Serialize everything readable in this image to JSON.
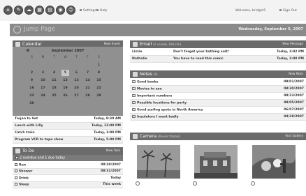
{
  "toolbar": {
    "icons": [
      "home-icon",
      "paperclip-icon",
      "cloud-icon",
      "calendar-icon",
      "document-icon",
      "camera-icon",
      "people-icon"
    ],
    "settings_label": "Settings",
    "help_label": "Help",
    "welcome": "Welcome, bridget1",
    "signout_label": "Sign Out"
  },
  "header": {
    "title": "Jump Page",
    "date": "Wednesday, September 5, 2007"
  },
  "calendar": {
    "title": "Calendar",
    "action": "New Event",
    "month": "September 2007",
    "days_of_week": [
      "S",
      "M",
      "T",
      "W",
      "T",
      "F",
      "S"
    ],
    "weeks": [
      [
        "",
        "",
        "",
        "",
        "",
        "",
        "1"
      ],
      [
        "2",
        "3",
        "4",
        "5",
        "6",
        "7",
        "8"
      ],
      [
        "9",
        "10",
        "11",
        "12",
        "13",
        "14",
        "15"
      ],
      [
        "16",
        "17",
        "18",
        "19",
        "20",
        "21",
        "22"
      ],
      [
        "23",
        "24",
        "25",
        "26",
        "27",
        "28",
        "29"
      ],
      [
        "30",
        "",
        "",
        "",
        "",
        "",
        ""
      ]
    ],
    "today": "5",
    "events": [
      {
        "name": "Trojan to Vet",
        "when": "Today, 9:30 AM"
      },
      {
        "name": "Lunch with Lilly",
        "when": "Today, 12:00 PM"
      },
      {
        "name": "Catch train",
        "when": "Today, 3:00 PM"
      },
      {
        "name": "Program VCR to tape show",
        "when": "Today, 5:00 PM"
      }
    ]
  },
  "todo": {
    "title": "To Do",
    "action": "New Task",
    "summary": "2 overdue and 1 due today",
    "tasks": [
      {
        "name": "Run",
        "due": "08/30/2007"
      },
      {
        "name": "Shower",
        "due": "08/31/2007"
      },
      {
        "name": "Drink",
        "due": "Today"
      },
      {
        "name": "Sleep",
        "due": "This week"
      }
    ]
  },
  "email": {
    "title": "Email",
    "subtitle": "(2 unread, 10% full)",
    "action": "New Message",
    "messages": [
      {
        "from": "Lizzie",
        "subject": "Don't forget your bathing suit!",
        "when": "Today, 3:02 PM"
      },
      {
        "from": "Nathalie",
        "subject": "You have to read this comic",
        "when": "Today, 3:00 PM"
      }
    ]
  },
  "notes": {
    "title": "Notes",
    "subtitle": "(6)",
    "action": "New Note",
    "items": [
      {
        "name": "Good books",
        "date": "09/01/2007"
      },
      {
        "name": "Movies to see",
        "date": "08/30/2007"
      },
      {
        "name": "Important numbers",
        "date": "08/23/2007"
      },
      {
        "name": "Possible locations for party",
        "date": "08/05/2007"
      },
      {
        "name": "Good surfing spots in North America",
        "date": "06/07/2007"
      },
      {
        "name": "Insulators I want badly",
        "date": "04/28/2007"
      }
    ]
  },
  "camera": {
    "title": "Camera",
    "subtitle": "(Recent Photos)",
    "action": "Visit Gallery",
    "photos": [
      "palm-trees-photo",
      "building-photo",
      "cactus-photo"
    ]
  },
  "colors": {
    "panel_head": "#6b6b6b",
    "calendar_bg": "#909090",
    "header_band": "#8a8a8a"
  }
}
